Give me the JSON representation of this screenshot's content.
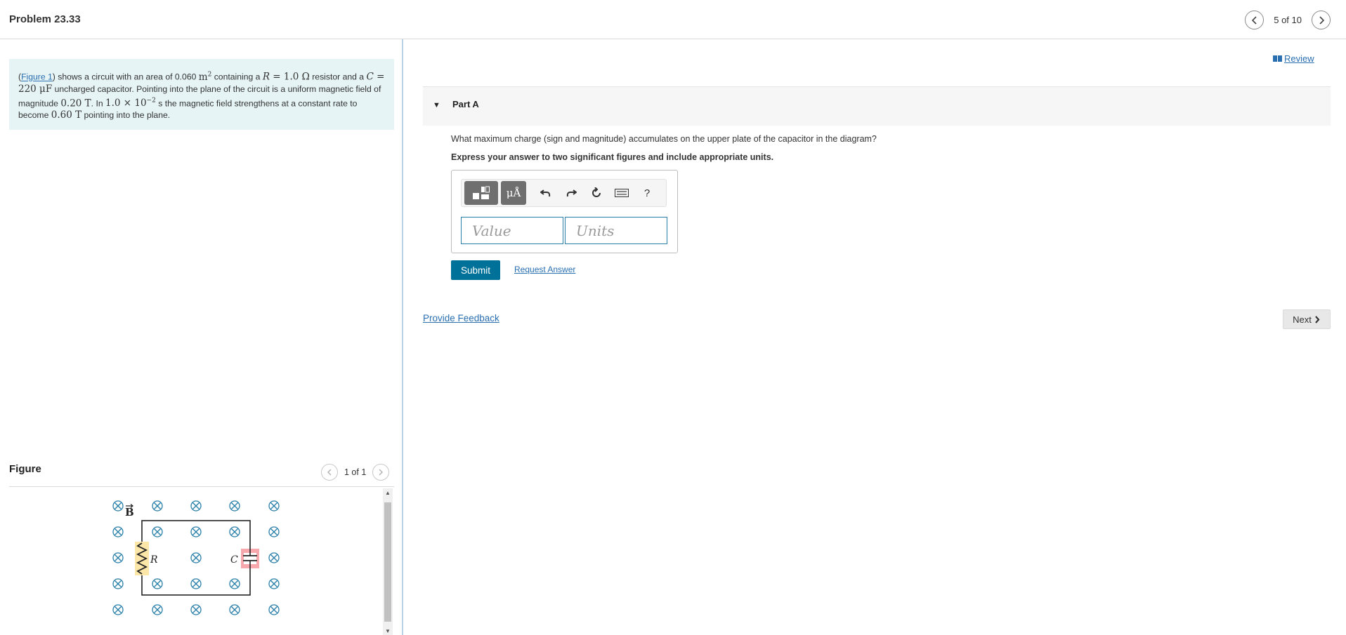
{
  "header": {
    "title": "Problem 23.33",
    "pager_text": "5 of 10",
    "prev_icon": "chevron-left-icon",
    "next_icon": "chevron-right-icon"
  },
  "problem": {
    "figure_link": "Figure 1",
    "text_shows": "shows a circuit with an area of 0.060",
    "area_unit": "m",
    "area_exp": "2",
    "text_containing": "containing a",
    "r_var": "R",
    "r_value": " = 1.0 Ω",
    "text_resistor": "resistor and a",
    "c_var": "C",
    "c_value": " = 220 μF",
    "text_capacitor": "uncharged capacitor. Pointing into the plane of the circuit is a uniform magnetic field of magnitude",
    "b_initial": "0.20 T",
    "text_in": ". In",
    "time_mant": "1.0 × 10",
    "time_exp": "−2",
    "text_strengthens": "s the magnetic field strengthens at a constant rate to become",
    "b_final": "0.60 T",
    "text_pointing": "pointing into the plane."
  },
  "figure": {
    "label": "Figure",
    "pager_text": "1 of 1",
    "b_label": "B",
    "r_label": "R",
    "c_label": "C"
  },
  "review": {
    "label": "Review",
    "icon": "book-icon"
  },
  "part": {
    "title": "Part A",
    "toggle_icon": "caret-down-icon"
  },
  "question": {
    "text": "What maximum charge (sign and magnitude) accumulates on the upper plate of the capacitor in the diagram?",
    "instruction": "Express your answer to two significant figures and include appropriate units."
  },
  "toolbar": {
    "mu_label": "μÅ",
    "help_label": "?",
    "icons": [
      "templates-icon",
      "units-icon",
      "undo-icon",
      "redo-icon",
      "reset-icon",
      "keyboard-icon",
      "help-icon"
    ]
  },
  "answer": {
    "value_placeholder": "Value",
    "units_placeholder": "Units"
  },
  "actions": {
    "submit": "Submit",
    "request_answer": "Request Answer",
    "provide_feedback": "Provide Feedback",
    "next": "Next"
  },
  "colors": {
    "accent": "#007199",
    "link": "#2a6fb0",
    "problem_bg": "#e6f4f5",
    "resistor_highlight": "#fde7a8",
    "capacitor_highlight": "#f7a8ad",
    "field_symbol": "#2a7fa8"
  }
}
